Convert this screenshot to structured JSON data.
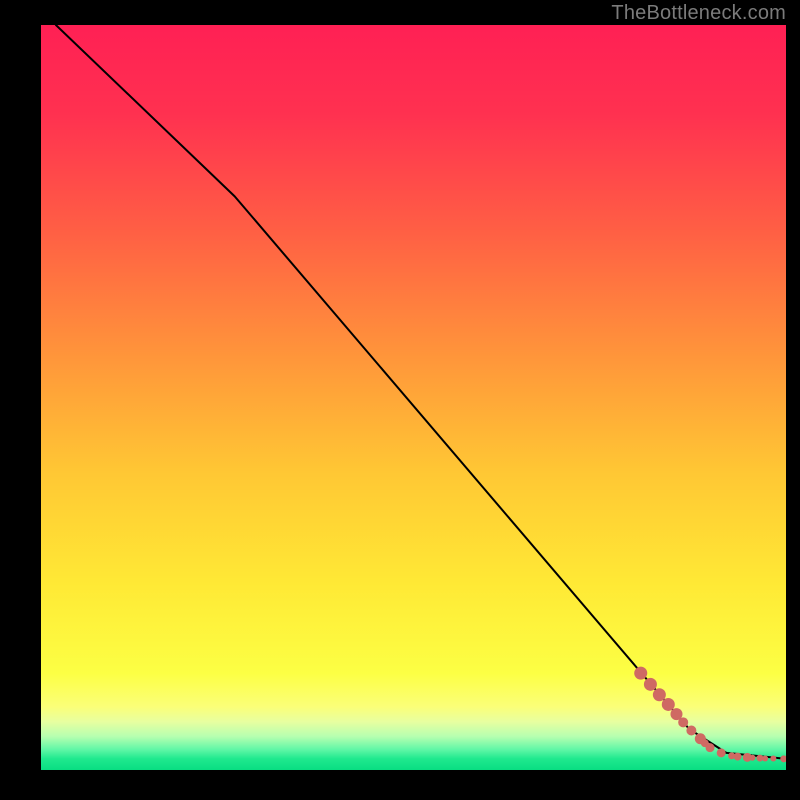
{
  "watermark": "TheBottleneck.com",
  "chart_data": {
    "type": "line",
    "title": "",
    "xlabel": "",
    "ylabel": "",
    "xlim": [
      0,
      100
    ],
    "ylim": [
      0,
      100
    ],
    "line_series": {
      "name": "curve",
      "points": [
        {
          "x": 2,
          "y": 100
        },
        {
          "x": 26,
          "y": 77
        },
        {
          "x": 87,
          "y": 5.5
        },
        {
          "x": 92,
          "y": 2.3
        },
        {
          "x": 100,
          "y": 1.5
        }
      ]
    },
    "marker_series": {
      "name": "dots",
      "color": "#cf6a63",
      "points": [
        {
          "x": 80.5,
          "y": 13.0,
          "r": 6.5
        },
        {
          "x": 81.8,
          "y": 11.5,
          "r": 6.5
        },
        {
          "x": 83.0,
          "y": 10.1,
          "r": 6.5
        },
        {
          "x": 84.2,
          "y": 8.8,
          "r": 6.5
        },
        {
          "x": 85.3,
          "y": 7.5,
          "r": 6.0
        },
        {
          "x": 86.2,
          "y": 6.4,
          "r": 5.0
        },
        {
          "x": 87.3,
          "y": 5.3,
          "r": 5.0
        },
        {
          "x": 88.5,
          "y": 4.2,
          "r": 5.5
        },
        {
          "x": 89.1,
          "y": 3.6,
          "r": 4.0
        },
        {
          "x": 89.8,
          "y": 3.0,
          "r": 4.5
        },
        {
          "x": 91.3,
          "y": 2.3,
          "r": 4.5
        },
        {
          "x": 92.7,
          "y": 1.9,
          "r": 3.5
        },
        {
          "x": 93.5,
          "y": 1.8,
          "r": 4.0
        },
        {
          "x": 94.8,
          "y": 1.7,
          "r": 4.5
        },
        {
          "x": 95.5,
          "y": 1.65,
          "r": 3.0
        },
        {
          "x": 96.5,
          "y": 1.6,
          "r": 3.5
        },
        {
          "x": 97.2,
          "y": 1.55,
          "r": 3.0
        },
        {
          "x": 98.3,
          "y": 1.55,
          "r": 3.0
        },
        {
          "x": 99.7,
          "y": 1.5,
          "r": 3.5
        }
      ]
    },
    "gradient_stops": [
      {
        "offset": 0.0,
        "color": "#ff2054"
      },
      {
        "offset": 0.12,
        "color": "#ff3150"
      },
      {
        "offset": 0.28,
        "color": "#ff6044"
      },
      {
        "offset": 0.45,
        "color": "#ff973a"
      },
      {
        "offset": 0.6,
        "color": "#ffc734"
      },
      {
        "offset": 0.75,
        "color": "#ffe935"
      },
      {
        "offset": 0.87,
        "color": "#fcff44"
      },
      {
        "offset": 0.915,
        "color": "#fbff78"
      },
      {
        "offset": 0.935,
        "color": "#e8ffa0"
      },
      {
        "offset": 0.955,
        "color": "#b6ffb0"
      },
      {
        "offset": 0.972,
        "color": "#62f7a7"
      },
      {
        "offset": 0.985,
        "color": "#1fe98e"
      },
      {
        "offset": 1.0,
        "color": "#09de82"
      }
    ]
  }
}
